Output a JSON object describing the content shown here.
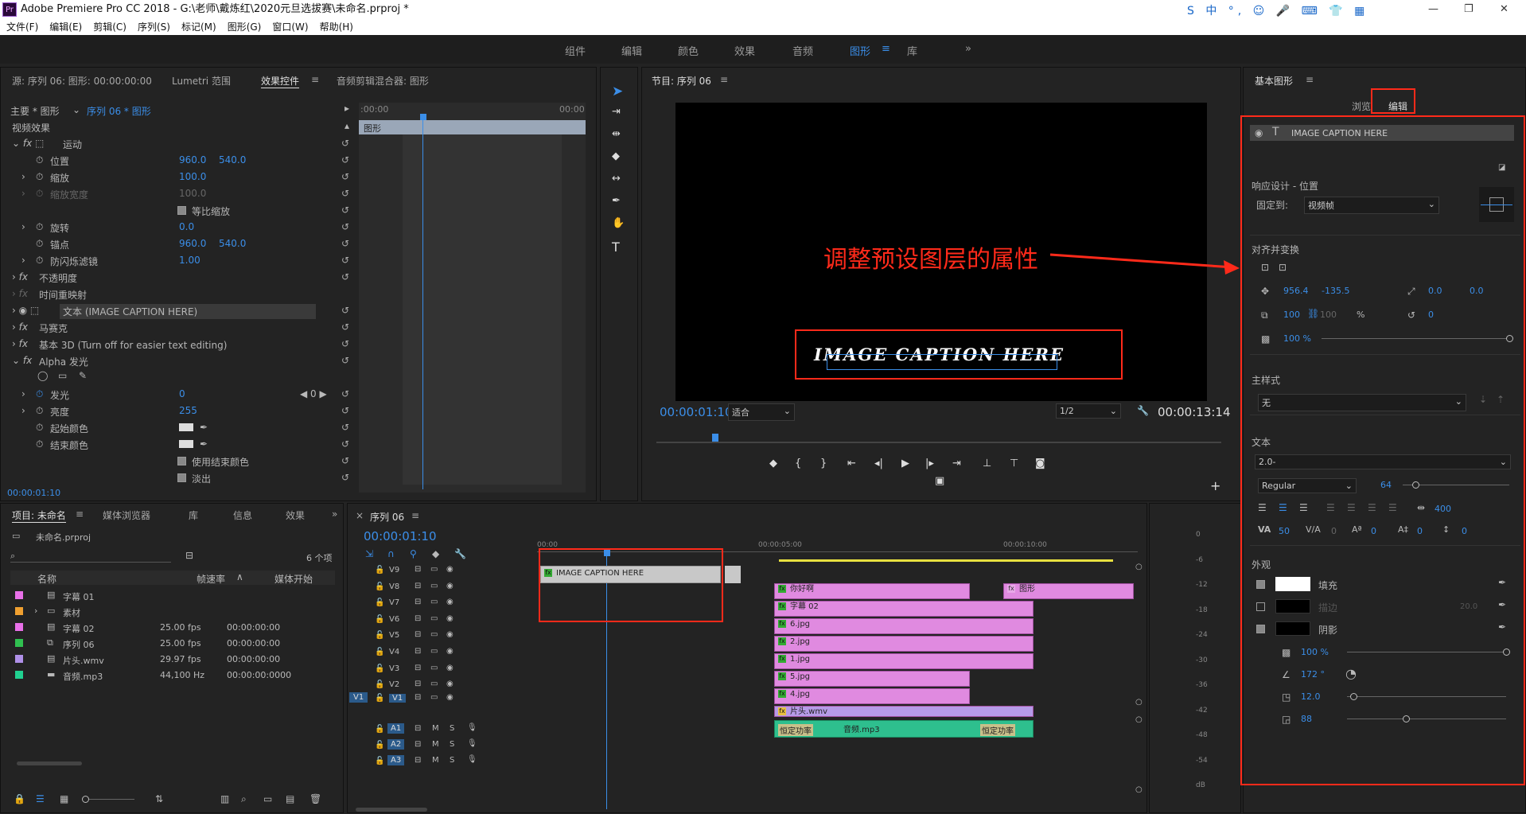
{
  "app": {
    "title": "Adobe Premiere Pro CC 2018 - G:\\老师\\戴炼红\\2020元旦选拔赛\\未命名.prproj *",
    "logo": "Pr",
    "ime_label": "S 中 °, ☺ 🎤 ⌨ 👕 ▦"
  },
  "menu": [
    "文件(F)",
    "编辑(E)",
    "剪辑(C)",
    "序列(S)",
    "标记(M)",
    "图形(G)",
    "窗口(W)",
    "帮助(H)"
  ],
  "workspaces": [
    "组件",
    "编辑",
    "颜色",
    "效果",
    "音频",
    "图形",
    "库"
  ],
  "workspace_active": "图形",
  "effect_controls": {
    "tabs": [
      "源: 序列 06: 图形: 00:00:00:00",
      "Lumetri 范围",
      "效果控件",
      "音频剪辑混合器: 图形"
    ],
    "master": "主要 * 图形",
    "sequence": "序列 06 * 图形",
    "time_start": ":00:00",
    "time_end": "00:00",
    "clip_label": "图形",
    "video_effects": "视频效果",
    "motion": "运动",
    "position_label": "位置",
    "position_x": "960.0",
    "position_y": "540.0",
    "scale_label": "缩放",
    "scale_value": "100.0",
    "scale_width_label": "缩放宽度",
    "scale_width_value": "100.0",
    "uniform_scale": "等比缩放",
    "rotation_label": "旋转",
    "rotation_value": "0.0",
    "anchor_label": "锚点",
    "anchor_x": "960.0",
    "anchor_y": "540.0",
    "flicker_label": "防闪烁滤镜",
    "flicker_value": "1.00",
    "opacity": "不透明度",
    "time_remap": "时间重映射",
    "text_layer": "文本 (IMAGE CAPTION HERE)",
    "mosaic": "马赛克",
    "basic3d": "基本 3D (Turn off for easier text editing)",
    "alpha_glow": "Alpha 发光",
    "glow_label": "发光",
    "glow_value": "0",
    "glow_kf": "0",
    "brightness_label": "亮度",
    "brightness_value": "255",
    "start_color": "起始颜色",
    "end_color": "结束颜色",
    "use_end_color": "使用结束颜色",
    "fade_out": "淡出",
    "timecode": "00:00:01:10"
  },
  "program": {
    "title": "节目: 序列 06",
    "caption": "IMAGE CAPTION HERE",
    "annotation": "调整预设图层的属性",
    "timecode": "00:00:01:10",
    "fit": "适合",
    "resolution": "1/2",
    "duration": "00:00:13:14"
  },
  "project": {
    "tabs": [
      "项目: 未命名",
      "媒体浏览器",
      "库",
      "信息",
      "效果"
    ],
    "file": "未命名.prproj",
    "count": "6 个项",
    "columns": [
      "名称",
      "帧速率",
      "媒体开始"
    ],
    "items": [
      {
        "name": "字幕 01",
        "rate": "",
        "start": "",
        "color": "#e870e8"
      },
      {
        "name": "素材",
        "rate": "",
        "start": "",
        "color": "#f0a030"
      },
      {
        "name": "字幕 02",
        "rate": "25.00 fps",
        "start": "00:00:00:00",
        "color": "#e870e8"
      },
      {
        "name": "序列 06",
        "rate": "25.00 fps",
        "start": "00:00:00:00",
        "color": "#30c050"
      },
      {
        "name": "片头.wmv",
        "rate": "29.97 fps",
        "start": "00:00:00:00",
        "color": "#b090e8"
      },
      {
        "name": "音频.mp3",
        "rate": "44,100 Hz",
        "start": "00:00:00:0000",
        "color": "#20d090"
      }
    ]
  },
  "timeline": {
    "title": "序列 06",
    "timecode": "00:00:01:10",
    "ruler": [
      "00:00",
      "00:00:05:00",
      "00:00:10:00"
    ],
    "video_tracks": [
      "V9",
      "V8",
      "V7",
      "V6",
      "V5",
      "V4",
      "V3",
      "V2",
      "V1"
    ],
    "audio_tracks": [
      "A1",
      "A2",
      "A3"
    ],
    "source_v": "V1",
    "clips": {
      "caption": "IMAGE CAPTION HERE",
      "hello": "你好啊",
      "graphic": "图形",
      "sub02": "字幕 02",
      "j6": "6.jpg",
      "j2": "2.jpg",
      "j1": "1.jpg",
      "j5": "5.jpg",
      "j4": "4.jpg",
      "intro": "片头.wmv",
      "audio": "音频.mp3",
      "const_power": "恒定功率"
    },
    "mute": "M",
    "solo": "S",
    "meter_ticks": [
      "0",
      "-6",
      "-12",
      "-18",
      "-24",
      "-30",
      "-36",
      "-42",
      "-48",
      "-54",
      "dB"
    ]
  },
  "essential_graphics": {
    "title": "基本图形",
    "tab_browse": "浏览",
    "tab_edit": "编辑",
    "layer": "IMAGE CAPTION HERE",
    "responsive_title": "响应设计 - 位置",
    "pin_label": "固定到:",
    "pin_value": "视频帧",
    "align_title": "对齐并变换",
    "pos_x": "956.4",
    "pos_y": "-135.5",
    "anchor_x": "0.0",
    "anchor_y": "0.0",
    "scale": "100",
    "scale2": "100",
    "scale_unit": "%",
    "rotation": "0",
    "opacity": "100 %",
    "master_style_title": "主样式",
    "master_style": "无",
    "text_title": "文本",
    "font": "2.0-",
    "font_style": "Regular",
    "font_size": "64",
    "tracking": "400",
    "kerning": "50",
    "va2": "0",
    "baseline": "0",
    "tsume": "0",
    "leading": "0",
    "appearance_title": "外观",
    "fill": "填充",
    "stroke": "描边",
    "stroke_width": "20.0",
    "shadow": "阴影",
    "shadow_opacity": "100 %",
    "shadow_angle": "172 °",
    "shadow_distance": "12.0",
    "shadow_size": "88"
  },
  "colors": {
    "accent": "#3b8ee8",
    "annotation": "#ff2a1a",
    "clip_pink": "#e08ae0"
  }
}
